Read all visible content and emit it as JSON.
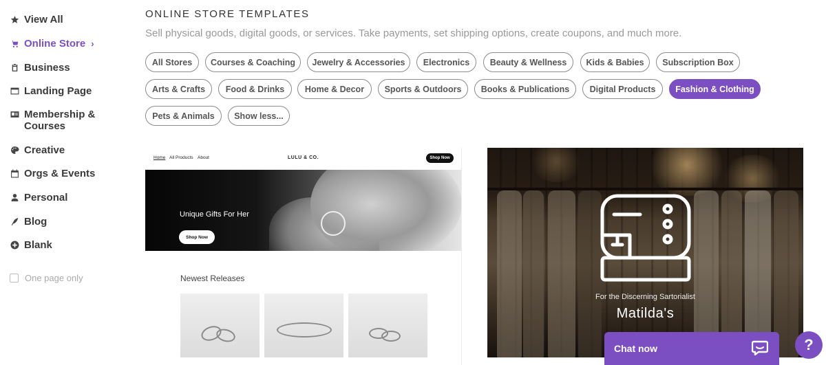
{
  "sidebar": {
    "items": [
      {
        "label": "View All",
        "icon": "star-icon"
      },
      {
        "label": "Online Store",
        "icon": "cart-icon",
        "active": true,
        "chevron": "›"
      },
      {
        "label": "Business",
        "icon": "clipboard-icon"
      },
      {
        "label": "Landing Page",
        "icon": "browser-window-icon"
      },
      {
        "label": "Membership &",
        "label2": "Courses",
        "icon": "id-card-icon"
      },
      {
        "label": "Creative",
        "icon": "palette-icon"
      },
      {
        "label": "Orgs & Events",
        "icon": "calendar-icon"
      },
      {
        "label": "Personal",
        "icon": "user-icon"
      },
      {
        "label": "Blog",
        "icon": "quill-icon"
      },
      {
        "label": "Blank",
        "icon": "plus-circle-icon"
      }
    ],
    "one_page_only": "One page only"
  },
  "header": {
    "title": "ONLINE STORE TEMPLATES",
    "subtitle": "Sell physical goods, digital goods, or services. Take payments, set shipping options, create coupons, and much more."
  },
  "filters": {
    "chips": [
      "All Stores",
      "Courses & Coaching",
      "Jewelry & Accessories",
      "Electronics",
      "Beauty & Wellness",
      "Kids & Babies",
      "Subscription Box",
      "Arts & Crafts",
      "Food & Drinks",
      "Home & Decor",
      "Sports & Outdoors",
      "Books & Publications",
      "Digital Products",
      "Fashion & Clothing",
      "Pets & Animals",
      "Show less..."
    ],
    "active": "Fashion & Clothing"
  },
  "template1": {
    "nav_links": [
      "Home",
      "All Products",
      "About"
    ],
    "logo": "LULU & CO.",
    "nav_button": "Shop Now",
    "hero_text": "Unique Gifts For Her",
    "hero_button": "Shop Now",
    "section_title": "Newest Releases"
  },
  "template2": {
    "tagline": "For the Discerning Sartorialist",
    "name": "Matilda's",
    "icon": "sewing-machine-icon"
  },
  "chat": {
    "label": "Chat now",
    "icon": "chat-bubble-icon"
  },
  "help": {
    "label": "?"
  },
  "colors": {
    "accent": "#7b4fc2"
  }
}
